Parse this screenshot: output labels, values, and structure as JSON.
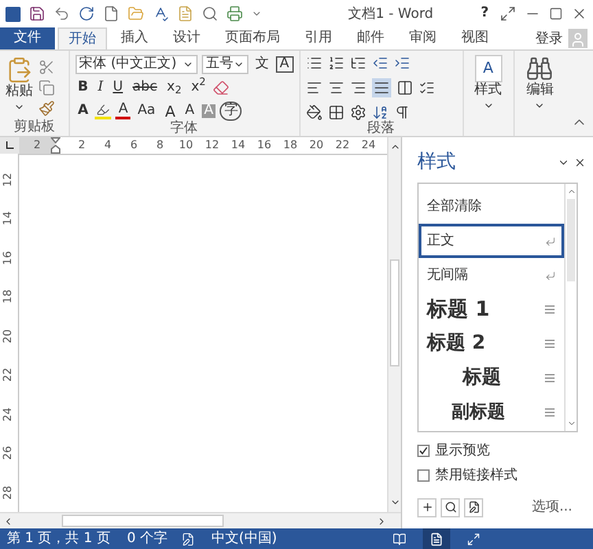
{
  "title_bar": {
    "title": "文档1 - Word",
    "help": "?"
  },
  "tabs": [
    {
      "label": "文件",
      "kind": "file",
      "selected": false
    },
    {
      "label": "开始",
      "kind": "tab",
      "selected": true
    },
    {
      "label": "插入",
      "kind": "tab",
      "selected": false
    },
    {
      "label": "设计",
      "kind": "tab",
      "selected": false
    },
    {
      "label": "页面布局",
      "kind": "tab",
      "selected": false
    },
    {
      "label": "引用",
      "kind": "tab",
      "selected": false
    },
    {
      "label": "邮件",
      "kind": "tab",
      "selected": false
    },
    {
      "label": "审阅",
      "kind": "tab",
      "selected": false
    },
    {
      "label": "视图",
      "kind": "tab",
      "selected": false
    }
  ],
  "account": {
    "label": "登录"
  },
  "ribbon": {
    "clipboard": {
      "paste": "粘贴",
      "label": "剪贴板"
    },
    "font": {
      "font_name": "宋体 (中文正文)",
      "font_size": "五号",
      "phonetic": "文",
      "char_border": "A",
      "bold": "B",
      "italic": "I",
      "underline": "U",
      "strike": "abc",
      "subscript": "x$_{2}$",
      "superscript": "x$^{2}$",
      "text_effect": "A",
      "font_color": "A",
      "change_case": "Aa",
      "grow": "A",
      "shrink": "A",
      "shading": "A",
      "enclose": "字",
      "label": "字体"
    },
    "paragraph": {
      "label": "段落"
    },
    "styles": {
      "label": "样式",
      "icon_text": "A"
    },
    "editing": {
      "label": "编辑"
    }
  },
  "ruler": {
    "horizontal": [
      "2",
      "2",
      "4",
      "6",
      "8",
      "10",
      "12",
      "14",
      "16",
      "18",
      "20",
      "22",
      "24"
    ],
    "vertical": [
      "12",
      "14",
      "16",
      "18",
      "20",
      "22",
      "24",
      "26",
      "28"
    ]
  },
  "styles_pane": {
    "title": "样式",
    "items": [
      {
        "label": "全部清除",
        "kind": "clear",
        "selected": false
      },
      {
        "label": "正文",
        "kind": "paragraph",
        "selected": true
      },
      {
        "label": "无间隔",
        "kind": "paragraph",
        "selected": false
      },
      {
        "label": "标题 1",
        "kind": "heading1",
        "selected": false
      },
      {
        "label": "标题 2",
        "kind": "heading2",
        "selected": false
      },
      {
        "label": "标题",
        "kind": "title",
        "selected": false
      },
      {
        "label": "副标题",
        "kind": "subtitle",
        "selected": false
      }
    ],
    "options": [
      {
        "label": "显示预览",
        "checked": true
      },
      {
        "label": "禁用链接样式",
        "checked": false
      }
    ],
    "options_link": "选项..."
  },
  "status_bar": {
    "page": "第 1 页，共 1 页",
    "words": "0 个字",
    "language": "中文(中国)"
  }
}
